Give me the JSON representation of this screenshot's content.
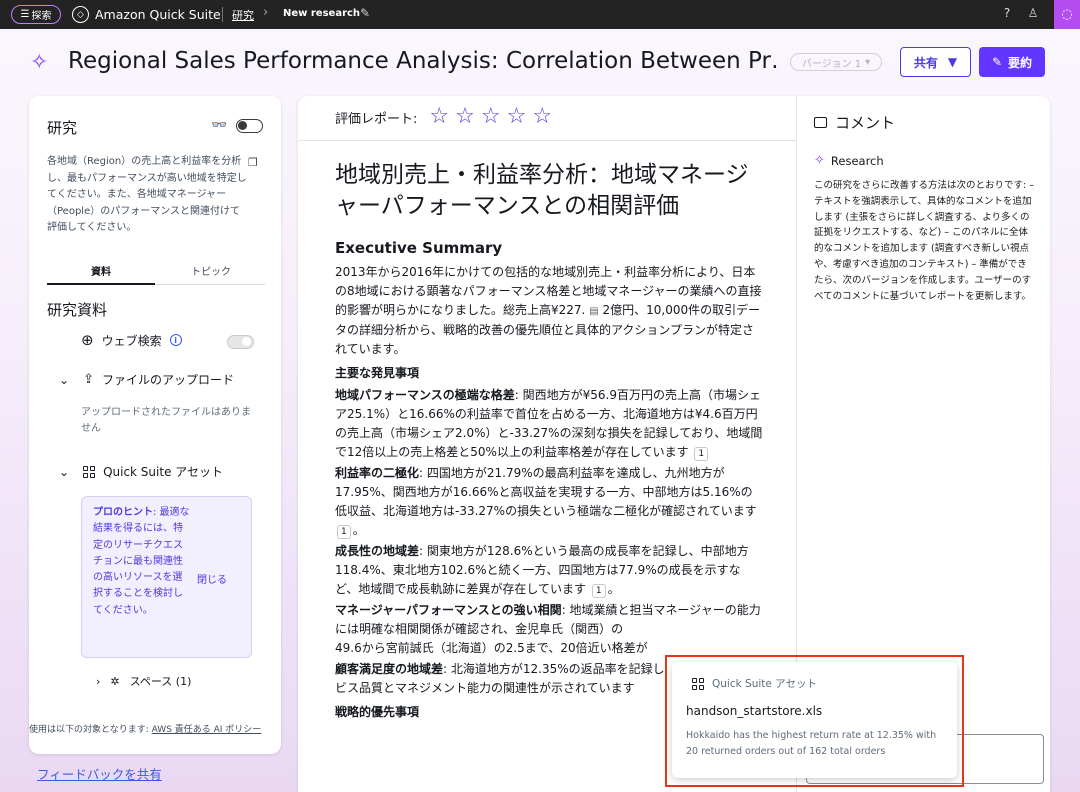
{
  "topbar": {
    "explore_label": "探索",
    "app_name": "Amazon Quick Suite",
    "breadcrumb_research": "研究",
    "breadcrumb_current": "New research"
  },
  "header": {
    "title": "Regional Sales Performance Analysis: Correlation Between Pr…",
    "version": "バージョン 1",
    "share_label": "共有",
    "summary_label": "要約"
  },
  "left": {
    "heading": "研究",
    "prompt": "各地域（Region）の売上高と利益率を分析し、最もパフォーマンスが高い地域を特定してください。また、各地域マネージャー（People）のパフォーマンスと関連付けて評価してください。",
    "tabs": [
      "資料",
      "トピック"
    ],
    "section_title": "研究資料",
    "web_search": "ウェブ検索",
    "file_upload": "ファイルのアップロード",
    "no_files": "アップロードされたファイルはありません",
    "assets": "Quick Suite アセット",
    "tip_bold": "プロのヒント",
    "tip_rest": ": 最適な結果を得るには、特定のリサーチクエスチョンに最も関連性の高いリソースを選択することを検討してください。",
    "tip_close": "閉じる",
    "space": "スペース (1)",
    "usage_prefix": "使用は以下の対象となります: ",
    "usage_link": "AWS 責任ある AI ポリシー",
    "feedback": "フィードバックを共有"
  },
  "main": {
    "rating_label": "評価レポート:",
    "doc_title": "地域別売上・利益率分析：地域マネージャーパフォーマンスとの相関評価",
    "exec_summary": "Executive Summary",
    "intro_a": "2013年から2016年にかけての包括的な地域別売上・利益率分析により、日本の8地域における顕著なパフォーマンス格差と地域マネージャーの業績への直接的影響が明らかになりました。総売上高¥227.",
    "intro_b": "2億円、10,000件の取引データの詳細分析から、戦略的改善の優先順位と具体的アクションプランが特定されています。",
    "key_findings": "主要な発見事項",
    "f1_bold": "地域パフォーマンスの極端な格差",
    "f1_text": ": 関西地方が¥56.9百万円の売上高（市場シェア25.1%）と16.66%の利益率で首位を占める一方、北海道地方は¥4.6百万円の売上高（市場シェア2.0%）と-33.27%の深刻な損失を記録しており、地域間で12倍以上の売上格差と50%以上の利益率格差が存在しています",
    "f2_bold": "利益率の二極化",
    "f2_text": ": 四国地方が21.79%の最高利益率を達成し、九州地方が17.95%、関西地方が16.66%と高収益を実現する一方、中部地方は5.16%の低収益、北海道地方は-33.27%の損失という極端な二極化が確認されています",
    "f3_bold": "成長性の地域差",
    "f3_text": ": 関東地方が128.6%という最高の成長率を記録し、中部地方118.4%、東北地方102.6%と続く一方、四国地方は77.9%の成長を示すなど、地域間で成長軌跡に差異が存在しています",
    "f4_bold": "マネージャーパフォーマンスとの強い相関",
    "f4_text": ": 地域業績と担当マネージャーの能力には明確な相関関係が確認され、金児阜氏（関西）の",
    "f4_text2": "49.6から宮前誠氏（北海道）の2.5まで、20倍近い格差が",
    "f5_bold": "顧客満足度の地域差",
    "f5_text": ": 北海道地方が12.35%の返品率を記録し",
    "f5_text2": "ビス品質とマネジメント能力の関連性が示されています",
    "cite1": "1",
    "next_heading": "戦略的優先事項"
  },
  "comments": {
    "title": "コメント",
    "research_label": "Research",
    "text": "この研究をさらに改善する方法は次のとおりです: – テキストを強調表示して、具体的なコメントを追加します (主張をさらに詳しく調査する、より多くの証拠をリクエストする、など) – このパネルに全体的なコメントを追加します (調査すべき新しい視点や、考慮すべき追加のコンテキスト) – 準備ができたら、次のバージョンを作成します。ユーザーのすべてのコメントに基づいてレポートを更新します。"
  },
  "popup": {
    "source": "Quick Suite アセット",
    "file": "handson_startstore.xls",
    "description": "Hokkaido has the highest return rate at 12.35% with 20 returned orders out of 162 total orders"
  },
  "colors": {
    "accent": "#6236ff",
    "highlight_outline": "#e8341b",
    "topbar": "#232323"
  }
}
